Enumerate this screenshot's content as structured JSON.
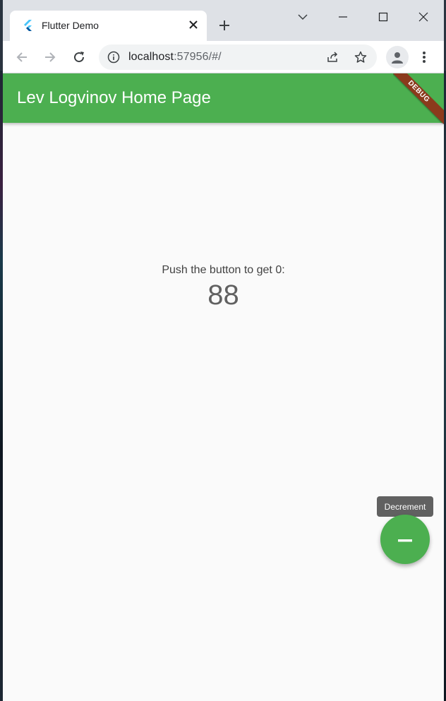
{
  "browser": {
    "tab": {
      "title": "Flutter Demo",
      "favicon": "flutter-logo-icon"
    },
    "url": {
      "host": "localhost",
      "rest": ":57956/#/"
    }
  },
  "app": {
    "title": "Lev Logvinov Home Page",
    "debug_banner": "DEBUG",
    "message": "Push the button to get 0:",
    "counter": "88",
    "fab": {
      "tooltip": "Decrement",
      "icon": "remove-icon"
    },
    "colors": {
      "primary": "#4caf50",
      "debug_banner": "#8b3a1c"
    }
  }
}
